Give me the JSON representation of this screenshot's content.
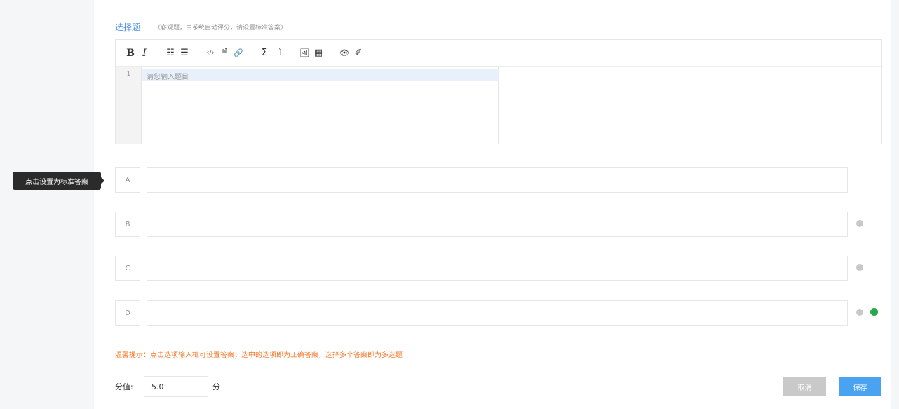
{
  "question": {
    "type_label": "选择题",
    "hint": "（客观题，由系统自动评分，请设置标准答案）"
  },
  "editor": {
    "toolbar": [
      {
        "name": "bold-icon",
        "glyph": "B"
      },
      {
        "name": "italic-icon",
        "glyph": "I"
      },
      {
        "name": "unordered-list-icon",
        "glyph": "☷"
      },
      {
        "name": "ordered-list-icon",
        "glyph": "☰"
      },
      {
        "name": "code-icon",
        "glyph": "‹/›"
      },
      {
        "name": "code-block-icon",
        "glyph": "🗎"
      },
      {
        "name": "link-icon",
        "glyph": "🔗"
      },
      {
        "name": "formula-icon",
        "glyph": "Σ"
      },
      {
        "name": "file-icon",
        "glyph": "🗋"
      },
      {
        "name": "image-icon",
        "glyph": "🖼"
      },
      {
        "name": "table-icon",
        "glyph": "▦"
      },
      {
        "name": "preview-icon",
        "glyph": "👁"
      },
      {
        "name": "eraser-icon",
        "glyph": "✐"
      }
    ],
    "line_number": "1",
    "placeholder": "请您输入题目"
  },
  "tooltip": "点击设置为标准答案",
  "options": [
    {
      "letter": "A",
      "value": "",
      "removable": false,
      "addable": false
    },
    {
      "letter": "B",
      "value": "",
      "removable": true,
      "addable": false
    },
    {
      "letter": "C",
      "value": "",
      "removable": true,
      "addable": false
    },
    {
      "letter": "D",
      "value": "",
      "removable": true,
      "addable": true
    }
  ],
  "tip": "温馨提示：点击选项输入框可设置答案；选中的选项即为正确答案，选择多个答案即为多选题",
  "score": {
    "label": "分值:",
    "value": "5.0",
    "unit": "分"
  },
  "buttons": {
    "cancel": "取消",
    "save": "保存"
  },
  "colors": {
    "accent": "#4aa3f0",
    "type_label": "#4a90e2",
    "tip": "#f5772a",
    "add": "#28a745",
    "disabled": "#c9c9c9"
  }
}
